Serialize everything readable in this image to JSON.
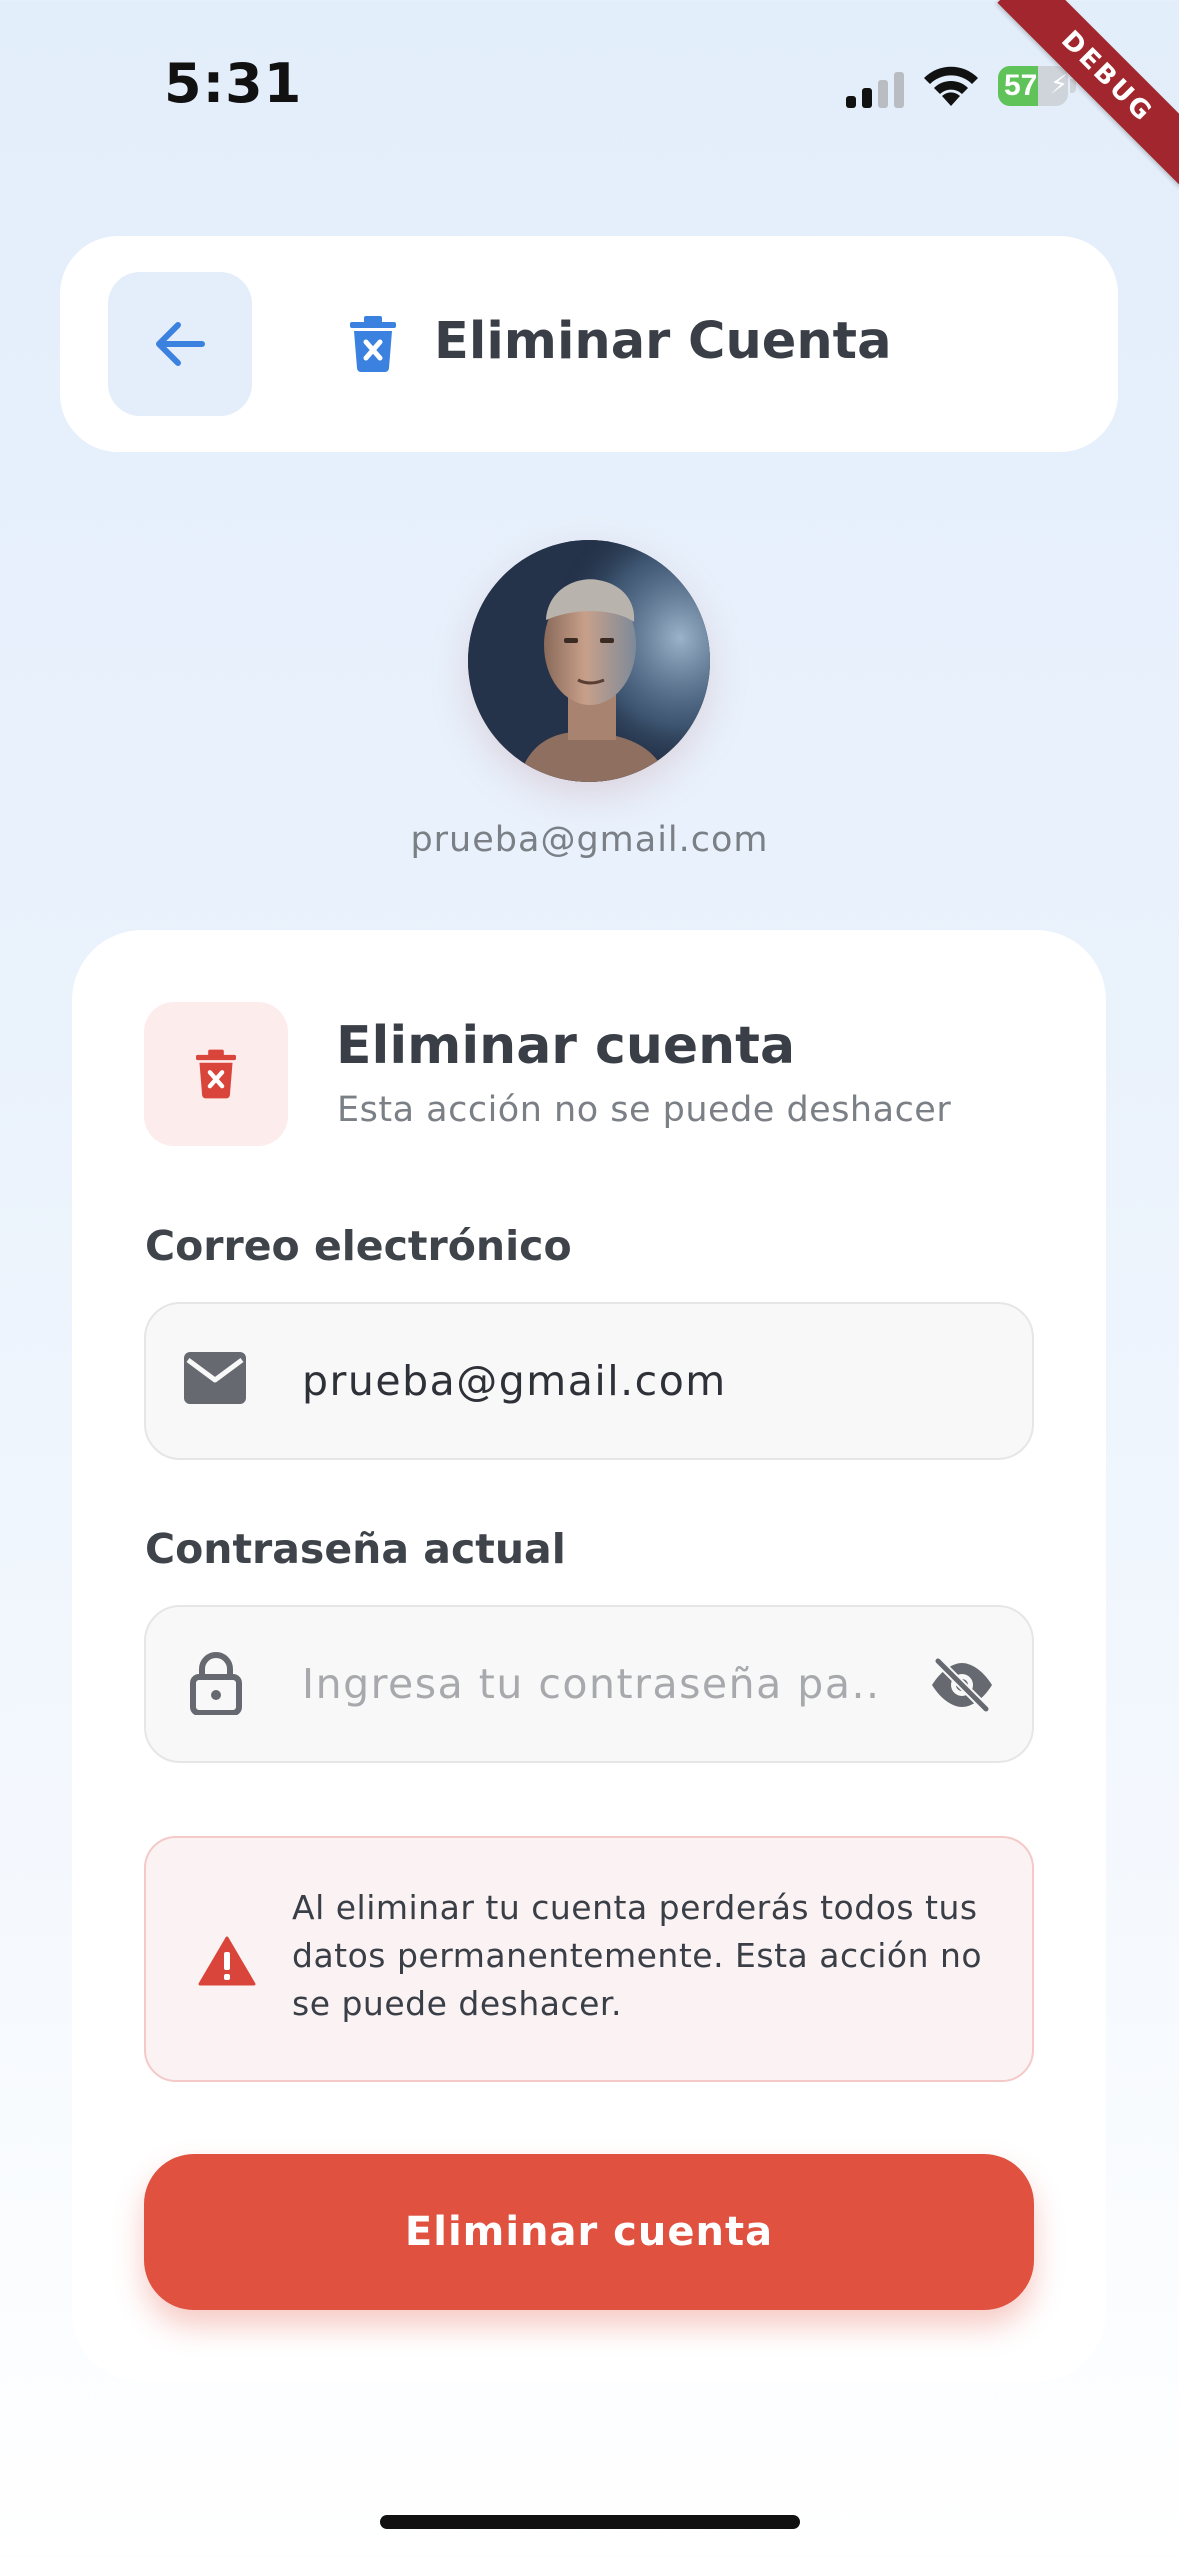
{
  "status_bar": {
    "time": "5:31",
    "battery_level": "57",
    "icons": [
      "signal-icon",
      "wifi-icon",
      "battery-charging-icon"
    ]
  },
  "debug_banner": "DEBUG",
  "header": {
    "title": "Eliminar Cuenta",
    "back_icon": "arrow-left-icon",
    "title_icon": "trash-x-icon"
  },
  "profile": {
    "email": "prueba@gmail.com"
  },
  "card": {
    "title": "Eliminar cuenta",
    "subtitle": "Esta acción no se puede deshacer",
    "email_field": {
      "label": "Correo electrónico",
      "value": "prueba@gmail.com",
      "icon": "envelope-icon"
    },
    "password_field": {
      "label": "Contraseña actual",
      "value": "",
      "placeholder": "Ingresa tu contraseña pa...",
      "icon": "lock-icon",
      "toggle_icon": "eye-off-icon"
    },
    "warning": {
      "text": "Al eliminar tu cuenta perderás todos tus datos permanentemente. Esta acción no se puede deshacer.",
      "icon": "warning-triangle-icon"
    },
    "submit_label": "Eliminar cuenta"
  },
  "colors": {
    "accent_blue": "#3b82e0",
    "danger_red": "#e05140",
    "danger_icon_red": "#d9453a",
    "text_dark": "#3a3f47",
    "text_muted": "#7b7f86"
  }
}
